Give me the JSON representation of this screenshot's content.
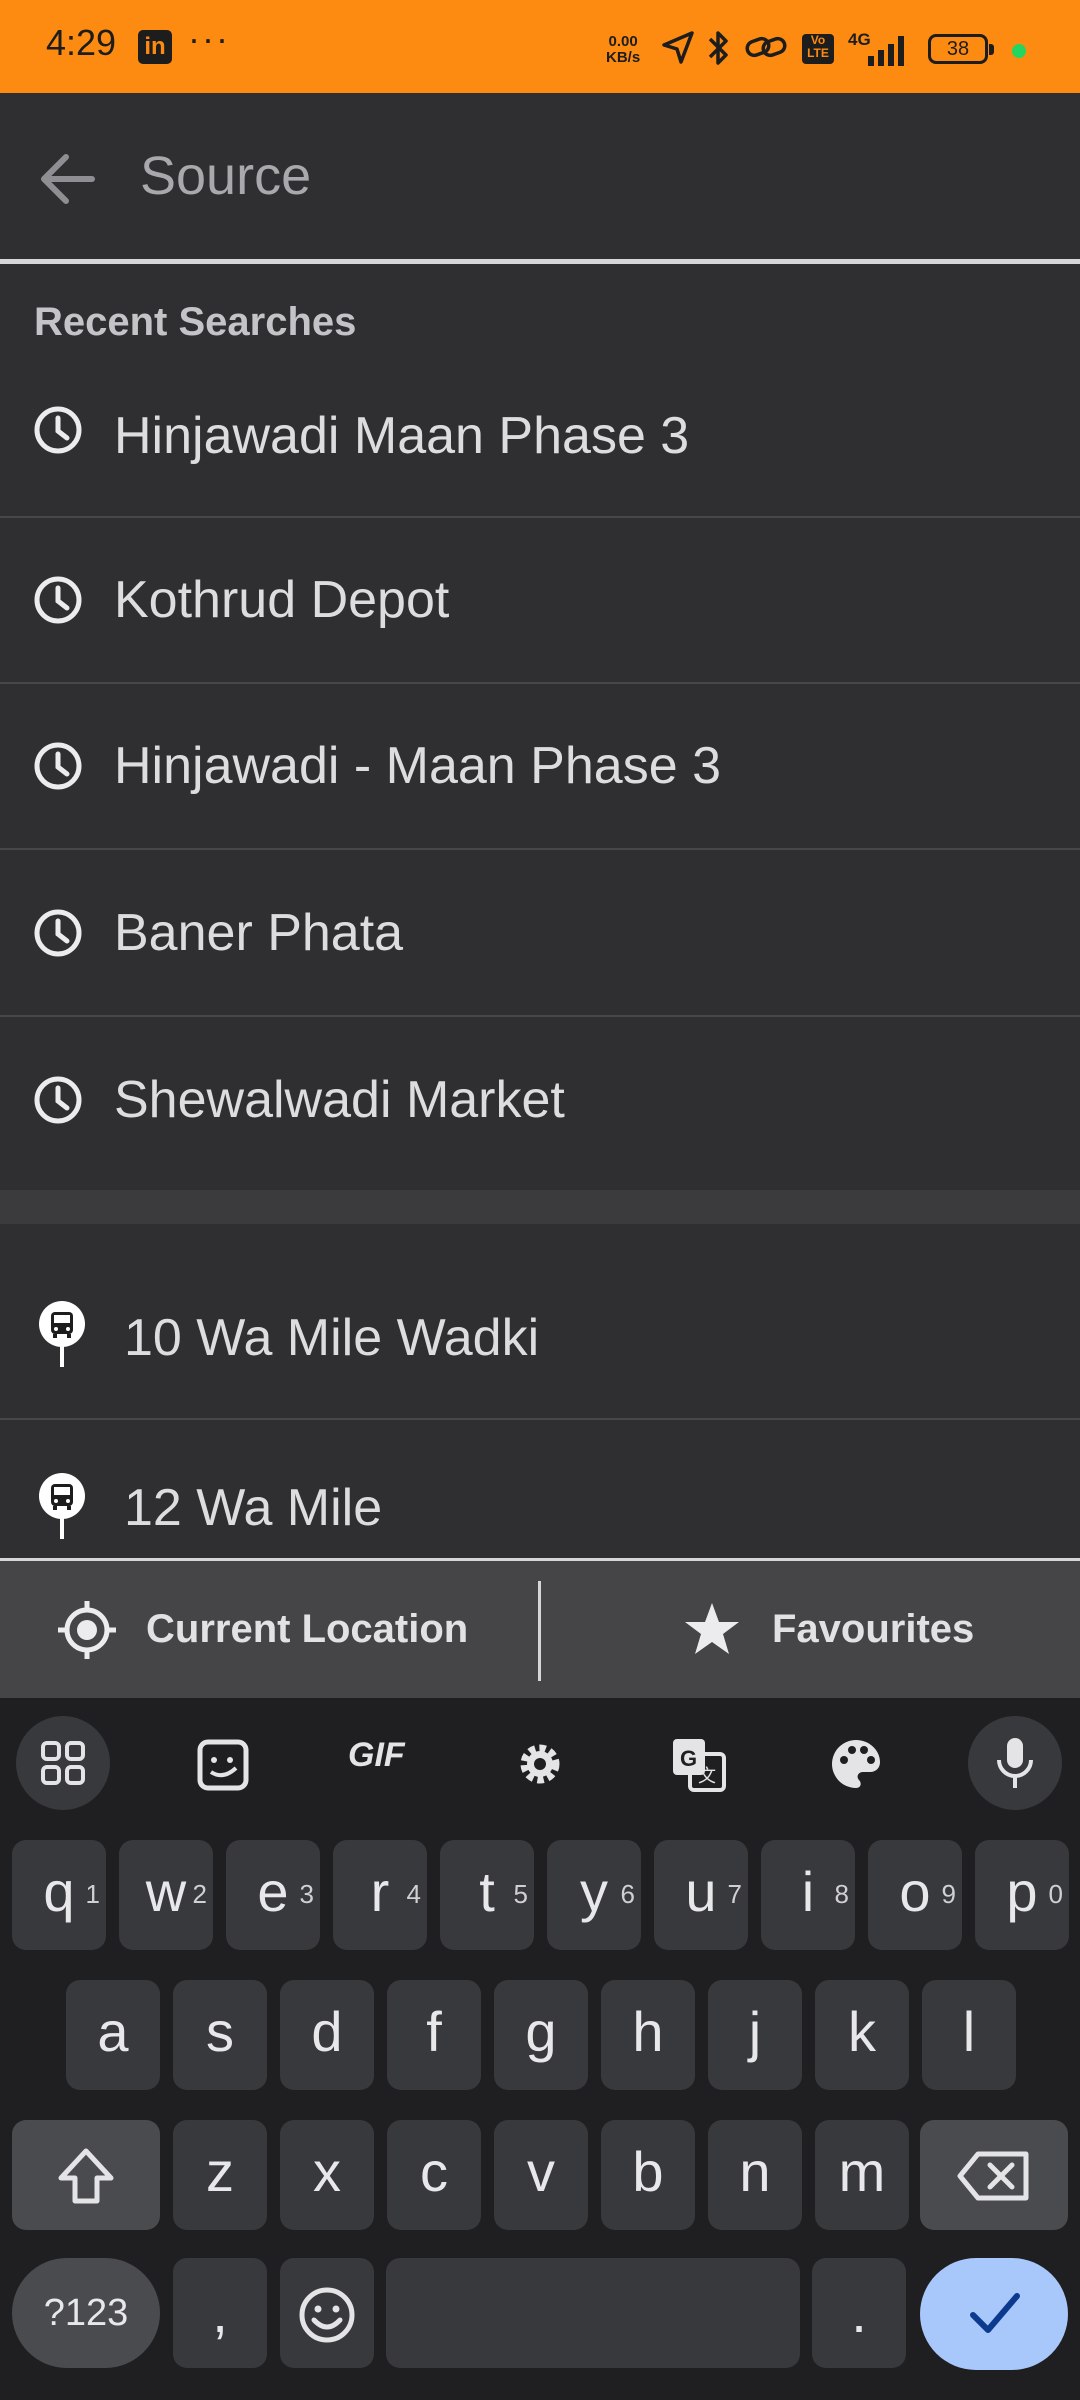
{
  "status_bar": {
    "time": "4:29",
    "linkedin_label": "in",
    "more": "···",
    "net_speed_value": "0.00",
    "net_speed_unit": "KB/s",
    "volte": "Vo LTE",
    "network": "4G",
    "battery": "38",
    "colors": {
      "background": "#fe8b11",
      "dot": "#24d65f"
    }
  },
  "header": {
    "title": "Source",
    "back_icon": "arrow-left-icon"
  },
  "recent": {
    "heading": "Recent Searches",
    "items": [
      {
        "label": "Hinjawadi Maan Phase 3",
        "icon": "clock-icon"
      },
      {
        "label": "Kothrud Depot",
        "icon": "clock-icon"
      },
      {
        "label": "Hinjawadi - Maan Phase 3",
        "icon": "clock-icon"
      },
      {
        "label": "Baner Phata",
        "icon": "clock-icon"
      },
      {
        "label": "Shewalwadi Market",
        "icon": "clock-icon"
      }
    ]
  },
  "stops": {
    "items": [
      {
        "label": "10 Wa Mile Wadki",
        "icon": "bus-stop-icon"
      },
      {
        "label": "12 Wa Mile",
        "icon": "bus-stop-icon"
      }
    ]
  },
  "bottom_bar": {
    "current_location": "Current Location",
    "favourites": "Favourites"
  },
  "keyboard": {
    "toolbar": {
      "gif": "GIF"
    },
    "row1": [
      {
        "k": "q",
        "n": "1"
      },
      {
        "k": "w",
        "n": "2"
      },
      {
        "k": "e",
        "n": "3"
      },
      {
        "k": "r",
        "n": "4"
      },
      {
        "k": "t",
        "n": "5"
      },
      {
        "k": "y",
        "n": "6"
      },
      {
        "k": "u",
        "n": "7"
      },
      {
        "k": "i",
        "n": "8"
      },
      {
        "k": "o",
        "n": "9"
      },
      {
        "k": "p",
        "n": "0"
      }
    ],
    "row2": [
      "a",
      "s",
      "d",
      "f",
      "g",
      "h",
      "j",
      "k",
      "l"
    ],
    "row3": [
      "z",
      "x",
      "c",
      "v",
      "b",
      "n",
      "m"
    ],
    "symbols": "?123",
    "comma": ",",
    "period": ".",
    "accent": "#a8c7fa"
  }
}
